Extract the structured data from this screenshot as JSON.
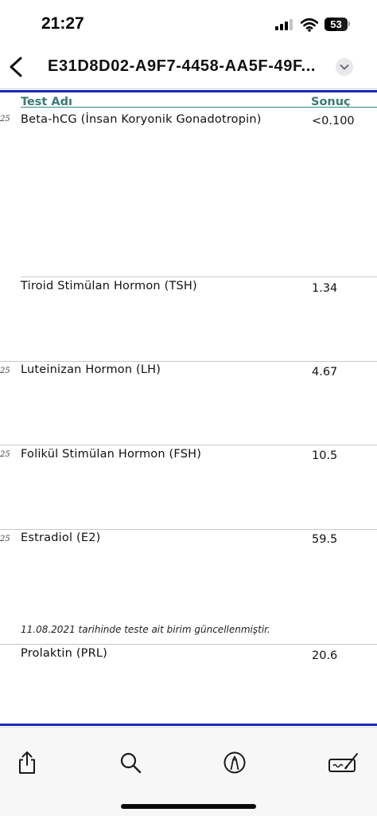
{
  "status_bar": {
    "time": "21:27",
    "battery_level": "53",
    "signal_icon": "cellular-signal-icon",
    "wifi_icon": "wifi-icon",
    "battery_icon": "battery-icon"
  },
  "nav": {
    "back_icon": "chevron-left-icon",
    "title": "E31D8D02-A9F7-4458-AA5F-49F...",
    "menu_icon": "chevron-down-icon"
  },
  "table": {
    "header_test": "Test Adı",
    "header_result": "Sonuç",
    "edge_marker": "25",
    "rows": [
      {
        "name": "Beta-hCG (İnsan Koryonik Gonadotropin)",
        "value": "<0.100"
      },
      {
        "name": "Tiroid Stimülan Hormon (TSH)",
        "value": "1.34"
      },
      {
        "name": "Luteinizan Hormon (LH)",
        "value": "4.67"
      },
      {
        "name": "Folikül Stimülan Hormon (FSH)",
        "value": "10.5"
      },
      {
        "name": "Estradiol (E2)",
        "value": "59.5"
      },
      {
        "name": "Prolaktin (PRL)",
        "value": "20.6"
      }
    ],
    "estradiol_note": "11.08.2021 tarihinde teste ait birim güncellenmiştir."
  },
  "toolbar": {
    "share_icon": "share-icon",
    "search_icon": "search-icon",
    "markup_icon": "markup-pen-icon",
    "signature_icon": "signature-icon"
  },
  "colors": {
    "header_text": "#3b7a73",
    "rule_blue": "#1c28b8",
    "rule_teal": "#2e8a82"
  }
}
